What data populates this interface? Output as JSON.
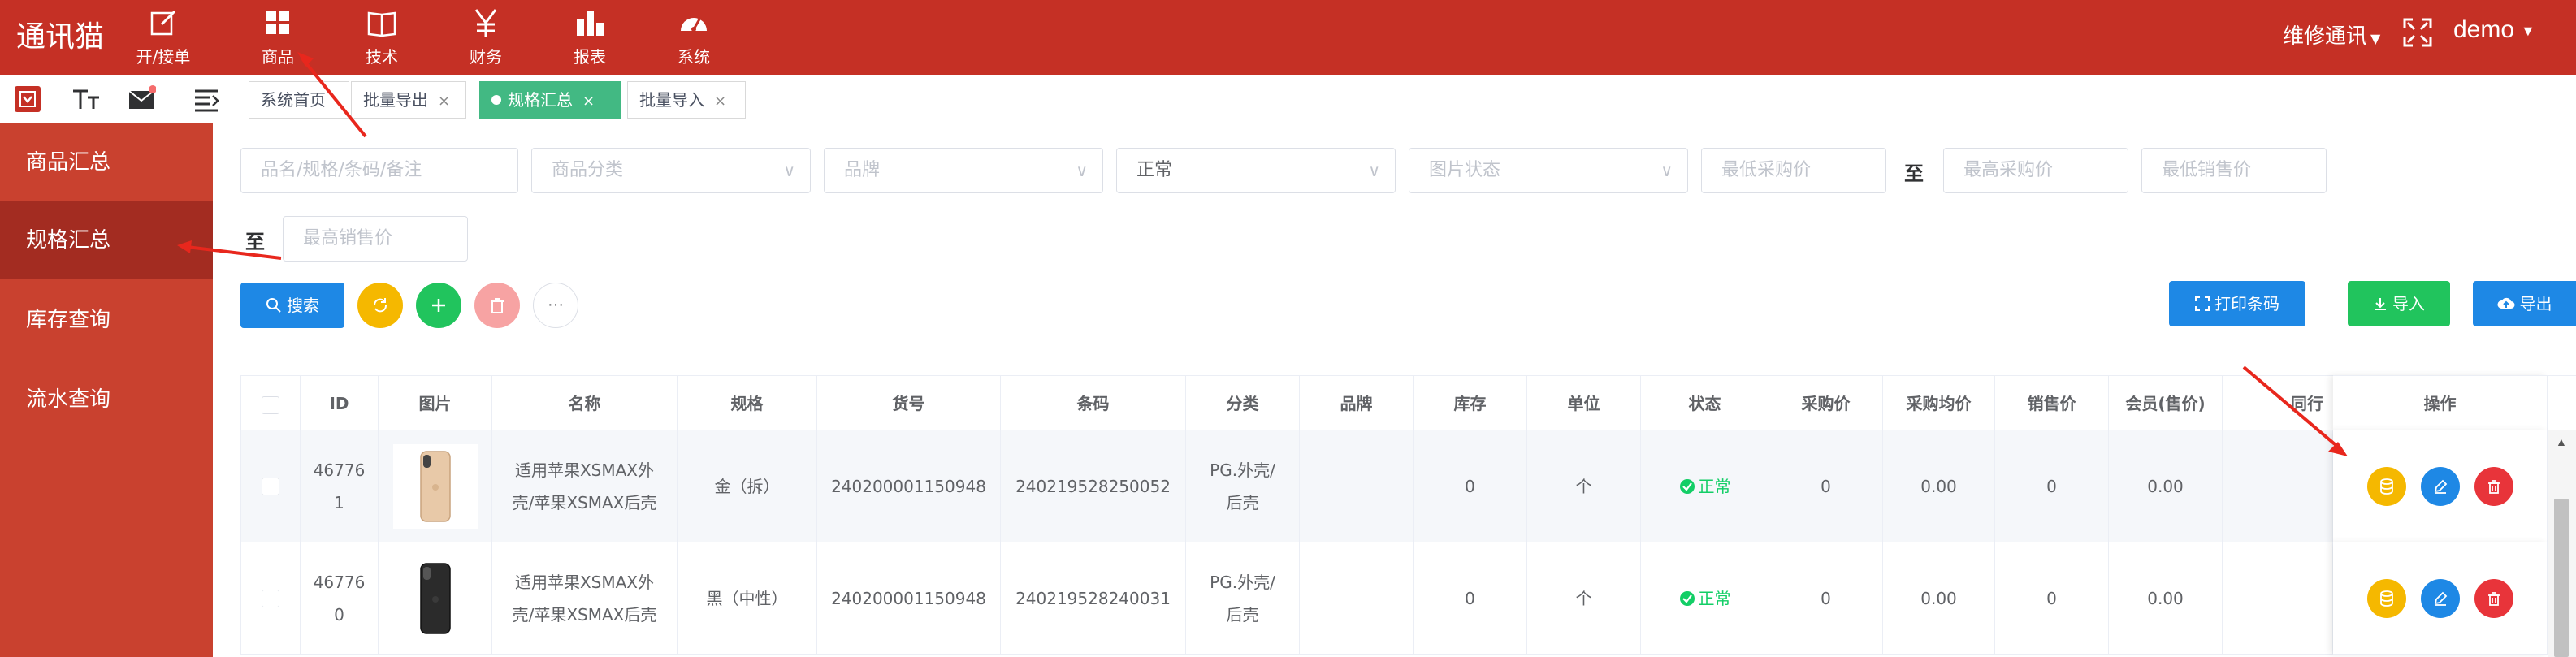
{
  "app": {
    "title": "通讯猫"
  },
  "topnav": [
    {
      "label": "开/接单",
      "icon": "edit-icon"
    },
    {
      "label": "商品",
      "icon": "grid-icon"
    },
    {
      "label": "技术",
      "icon": "book-icon"
    },
    {
      "label": "财务",
      "icon": "yen-icon"
    },
    {
      "label": "报表",
      "icon": "bar-chart-icon"
    },
    {
      "label": "系统",
      "icon": "dashboard-icon"
    }
  ],
  "header_right": {
    "repair_label": "维修通讯",
    "user": "demo"
  },
  "tabs": [
    {
      "label": "系统首页",
      "closable": false
    },
    {
      "label": "批量导出",
      "close": "×"
    },
    {
      "label": "规格汇总",
      "close": "×",
      "active": true
    },
    {
      "label": "批量导入",
      "close": "×"
    }
  ],
  "sidebar": [
    {
      "label": "商品汇总"
    },
    {
      "label": "规格汇总",
      "active": true
    },
    {
      "label": "库存查询"
    },
    {
      "label": "流水查询"
    }
  ],
  "filters": {
    "keyword_placeholder": "品名/规格/条码/备注",
    "category_placeholder": "商品分类",
    "brand_placeholder": "品牌",
    "status_value": "正常",
    "image_status_placeholder": "图片状态",
    "min_purchase_placeholder": "最低采购价",
    "to_label": "至",
    "max_purchase_placeholder": "最高采购价",
    "min_sale_placeholder": "最低销售价",
    "max_sale_placeholder": "最高销售价"
  },
  "actions": {
    "search": "搜索",
    "print_barcode": "打印条码",
    "import": "导入",
    "export": "导出",
    "more": "···"
  },
  "table": {
    "columns": [
      "ID",
      "图片",
      "名称",
      "规格",
      "货号",
      "条码",
      "分类",
      "品牌",
      "库存",
      "单位",
      "状态",
      "采购价",
      "采购均价",
      "销售价",
      "会员(售价)",
      "同行",
      "操作"
    ],
    "rows": [
      {
        "id_a": "46776",
        "id_b": "1",
        "name_a": "适用苹果XSMAX外",
        "name_b": "壳/苹果XSMAX后壳",
        "spec": "金（拆）",
        "sku": "240200001150948",
        "barcode": "240219528250052",
        "cat_a": "PG.外壳/",
        "cat_b": "后壳",
        "brand": "",
        "stock": "0",
        "unit": "个",
        "status": "正常",
        "purchase": "0",
        "avg_purchase": "0.00",
        "sale": "0",
        "member": "0.00",
        "phone_color": "#e8c9a8"
      },
      {
        "id_a": "46776",
        "id_b": "0",
        "name_a": "适用苹果XSMAX外",
        "name_b": "壳/苹果XSMAX后壳",
        "spec": "黑（中性）",
        "sku": "240200001150948",
        "barcode": "240219528240031",
        "cat_a": "PG.外壳/",
        "cat_b": "后壳",
        "brand": "",
        "stock": "0",
        "unit": "个",
        "status": "正常",
        "purchase": "0",
        "avg_purchase": "0.00",
        "sale": "0",
        "member": "0.00",
        "phone_color": "#2b2b2b"
      }
    ]
  },
  "colors": {
    "header_red": "#c53025",
    "sidebar_red": "#c9412f",
    "sidebar_active": "#a32c21",
    "primary_blue": "#1e88e5",
    "success_green": "#21c45d",
    "warning_yellow": "#f5b800",
    "danger_red": "#e8343a",
    "tab_active_green": "#42b983"
  }
}
